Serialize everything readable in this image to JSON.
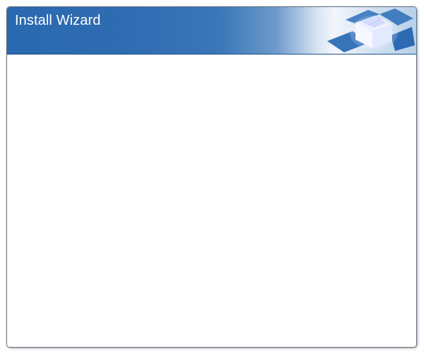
{
  "window": {
    "title": "Install Wizard",
    "icon": "open-box-icon"
  },
  "colors": {
    "header_dark": "#2a69b0",
    "header_light": "#f2f6fb",
    "border": "#5f6f80",
    "title_text": "#ffffff"
  }
}
